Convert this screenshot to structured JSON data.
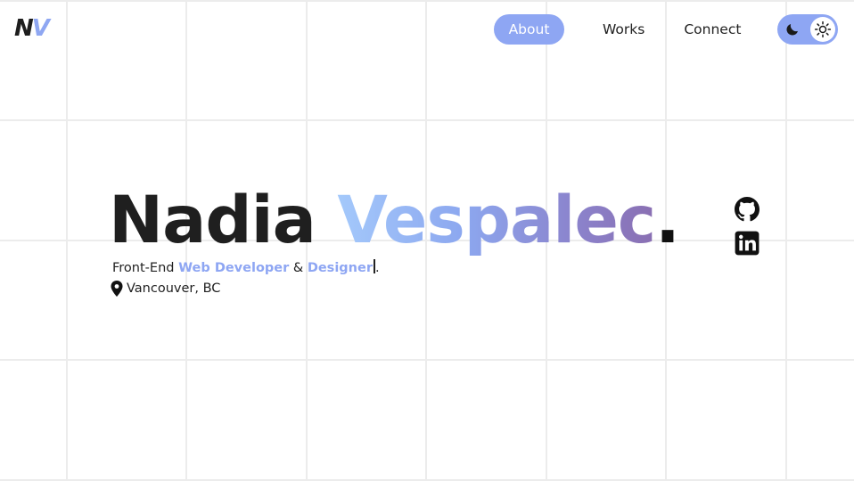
{
  "logo": {
    "first": "N",
    "second": "V"
  },
  "nav": {
    "items": [
      {
        "label": "About",
        "active": true
      },
      {
        "label": "Works",
        "active": false
      },
      {
        "label": "Connect",
        "active": false
      }
    ]
  },
  "theme_toggle": {
    "icons": [
      "moon-icon",
      "sun-icon"
    ],
    "selected": "light"
  },
  "hero": {
    "first_name": "Nadia",
    "last_name": "Vespalec",
    "period": ".",
    "tagline_prefix": "Front-End ",
    "role_1": "Web Developer",
    "conjunction": " & ",
    "role_2": "Designer",
    "tagline_end": ".",
    "location": "Vancouver, BC"
  },
  "social": {
    "icons": [
      "github-icon",
      "linkedin-icon"
    ]
  },
  "colors": {
    "accent": "#8ea6f3",
    "text": "#222222",
    "grid": "#ececec",
    "gradient": [
      "#a4c9fb",
      "#8ca7ef",
      "#8b83cc",
      "#8a6fb2"
    ]
  }
}
